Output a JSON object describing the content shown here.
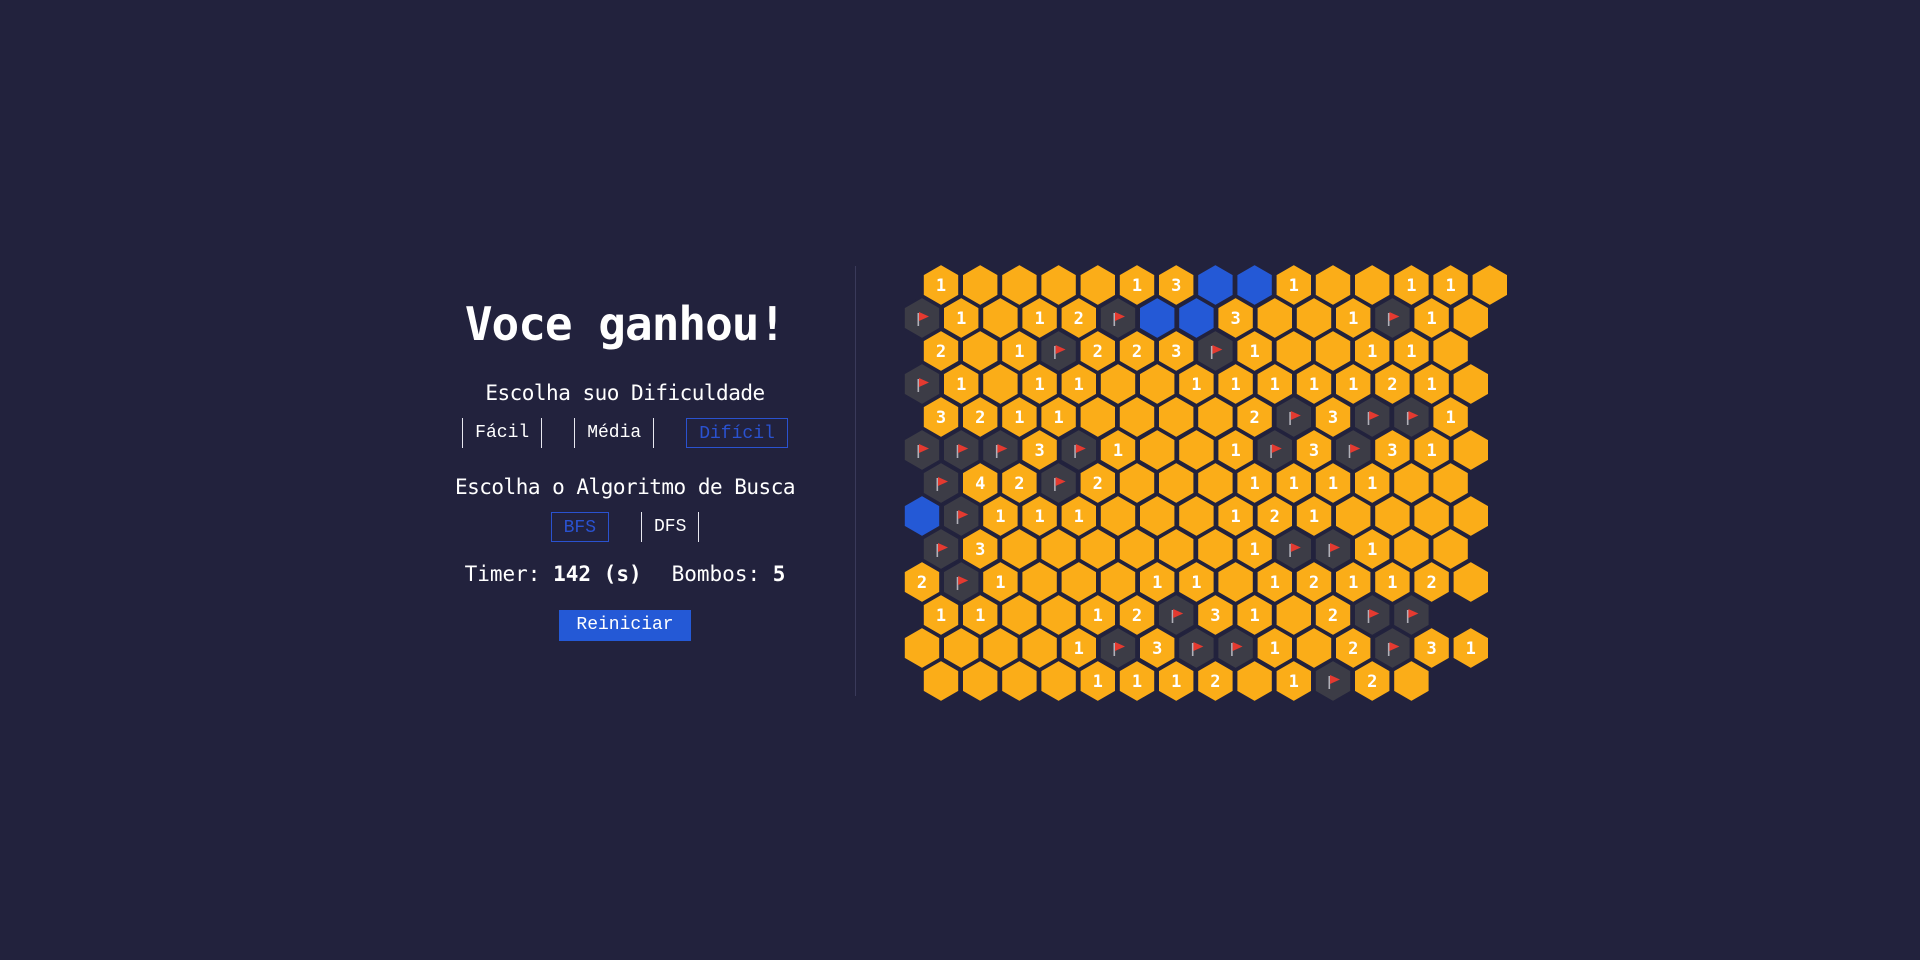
{
  "status": {
    "message": "Voce ganhou!"
  },
  "difficulty": {
    "label": "Escolha suo Dificuldade",
    "options": [
      {
        "label": "Fácil",
        "selected": false
      },
      {
        "label": "Média",
        "selected": false
      },
      {
        "label": "Difícil",
        "selected": true
      }
    ]
  },
  "algorithm": {
    "label": "Escolha o Algoritmo de Busca",
    "options": [
      {
        "label": "BFS",
        "selected": true
      },
      {
        "label": "DFS",
        "selected": false
      }
    ]
  },
  "stats": {
    "timer_label": "Timer:",
    "timer_value": "142",
    "timer_unit": "(s)",
    "bombs_label": "Bombos:",
    "bombs_value": "5"
  },
  "restart_label": "Reiniciar",
  "colors": {
    "background": "#22223d",
    "hex_revealed": "#fbad18",
    "hex_flagged": "#3c3c46",
    "hex_blue": "#2459d6",
    "flag_red": "#e43a30",
    "accent_blue": "#2a52d0"
  },
  "legend": {
    ".": "empty",
    "F": "flag",
    "B": "blue",
    "1-4": "number"
  },
  "board": {
    "rows": [
      "1....13BB1..11.",
      "F1.12FBB3..1F1.",
      "2.1F223F1..11.",
      "F1.11..1111121.",
      "3211....2F3FF1",
      "FFF3F1..1F3F31.",
      "F42F2...1111..",
      "BF111...121....",
      "F3......1FF1..",
      "2F1...11.12112.",
      "11..12F31.2FF",
      "....1F3FF1.2F31",
      "....1112.1F2."
    ]
  }
}
